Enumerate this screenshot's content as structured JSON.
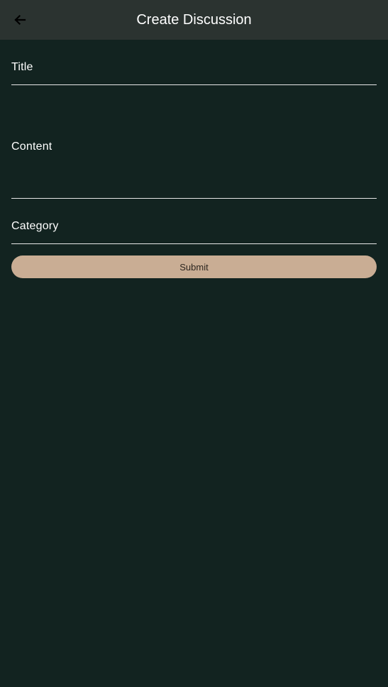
{
  "app_bar": {
    "title": "Create Discussion",
    "back_icon": "arrow-left-icon"
  },
  "form": {
    "title_label": "Title",
    "content_label": "Content",
    "category_label": "Category",
    "submit_label": "Submit"
  },
  "colors": {
    "background": "#122320",
    "app_bar": "#2b3330",
    "submit_button": "#c9ad94",
    "text": "#ffffff"
  }
}
